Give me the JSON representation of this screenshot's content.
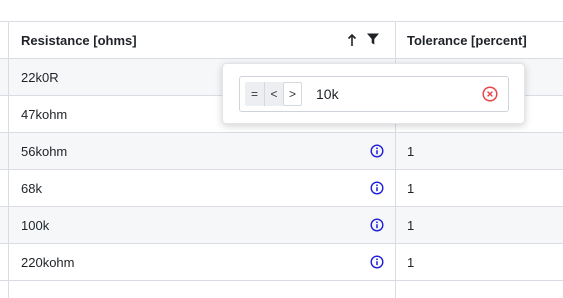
{
  "table": {
    "columns": [
      {
        "label": "Resistance [ohms]",
        "sort": "ascending",
        "filtered": true
      },
      {
        "label": "Tolerance [percent]"
      }
    ],
    "rows": [
      {
        "resistance": "22k0R",
        "tolerance": ""
      },
      {
        "resistance": "47kohm",
        "tolerance": ""
      },
      {
        "resistance": "56kohm",
        "tolerance": "1"
      },
      {
        "resistance": "68k",
        "tolerance": "1"
      },
      {
        "resistance": "100k",
        "tolerance": "1"
      },
      {
        "resistance": "220kohm",
        "tolerance": "1"
      }
    ]
  },
  "filter_popup": {
    "operators": [
      "=",
      "<",
      ">"
    ],
    "selected_operator": ">",
    "value": "10k",
    "clear_icon": "clear-circle-icon"
  },
  "icons": {
    "sort": "arrow-up-icon",
    "filter": "filter-icon",
    "info": "info-icon"
  },
  "colors": {
    "info": "#1d1dd6",
    "clear": "#e5484d",
    "row_alt": "#f6f7f9",
    "border": "#d9dde3"
  }
}
